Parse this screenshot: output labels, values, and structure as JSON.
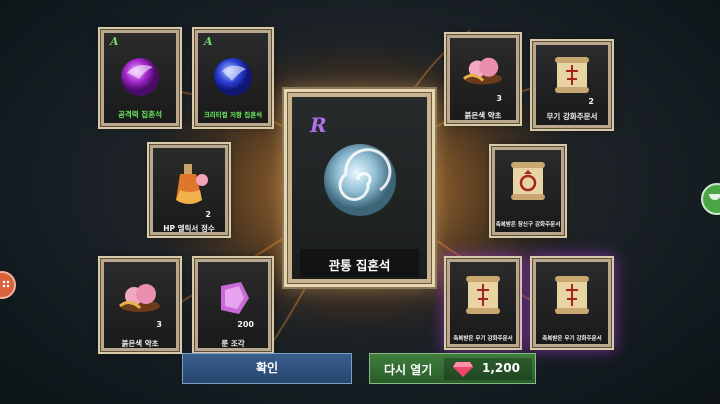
{
  "cards": {
    "attack_stone": {
      "rank": "A",
      "name": "공격력 집혼석"
    },
    "crit_stone": {
      "rank": "A",
      "name": "크리티컬 저항 집혼석"
    },
    "hp_elixir": {
      "qty": "2",
      "name": "HP 엘릭서 정수"
    },
    "red_potion_top": {
      "qty": "3",
      "name": "붉은색 약초"
    },
    "weapon_scroll_top": {
      "qty": "2",
      "name": "무기 강화주문서"
    },
    "accessory_scroll": {
      "name": "축복받은 장신구 강화주문서"
    },
    "red_potion_bottom": {
      "qty": "3",
      "name": "붉은색 약초"
    },
    "rune_piece": {
      "qty": "200",
      "name": "룬 조각"
    },
    "blessed_weapon_scroll_1": {
      "name": "축복받은 무기 강화주문서"
    },
    "blessed_weapon_scroll_2": {
      "name": "축복받은 무기 강화주문서"
    }
  },
  "featured": {
    "rank": "R",
    "name": "관통 집혼석"
  },
  "buttons": {
    "confirm": "확인",
    "reopen": "다시 열기",
    "reopen_cost": "1,200"
  },
  "colors": {
    "rank_a": "#6fd86c",
    "rank_r": "#b06ee8",
    "confirm_btn": "#2f5280",
    "reopen_btn": "#357035"
  },
  "icons": [
    "ruby-gem-icon",
    "chat-icon",
    "menu-dots-icon"
  ]
}
